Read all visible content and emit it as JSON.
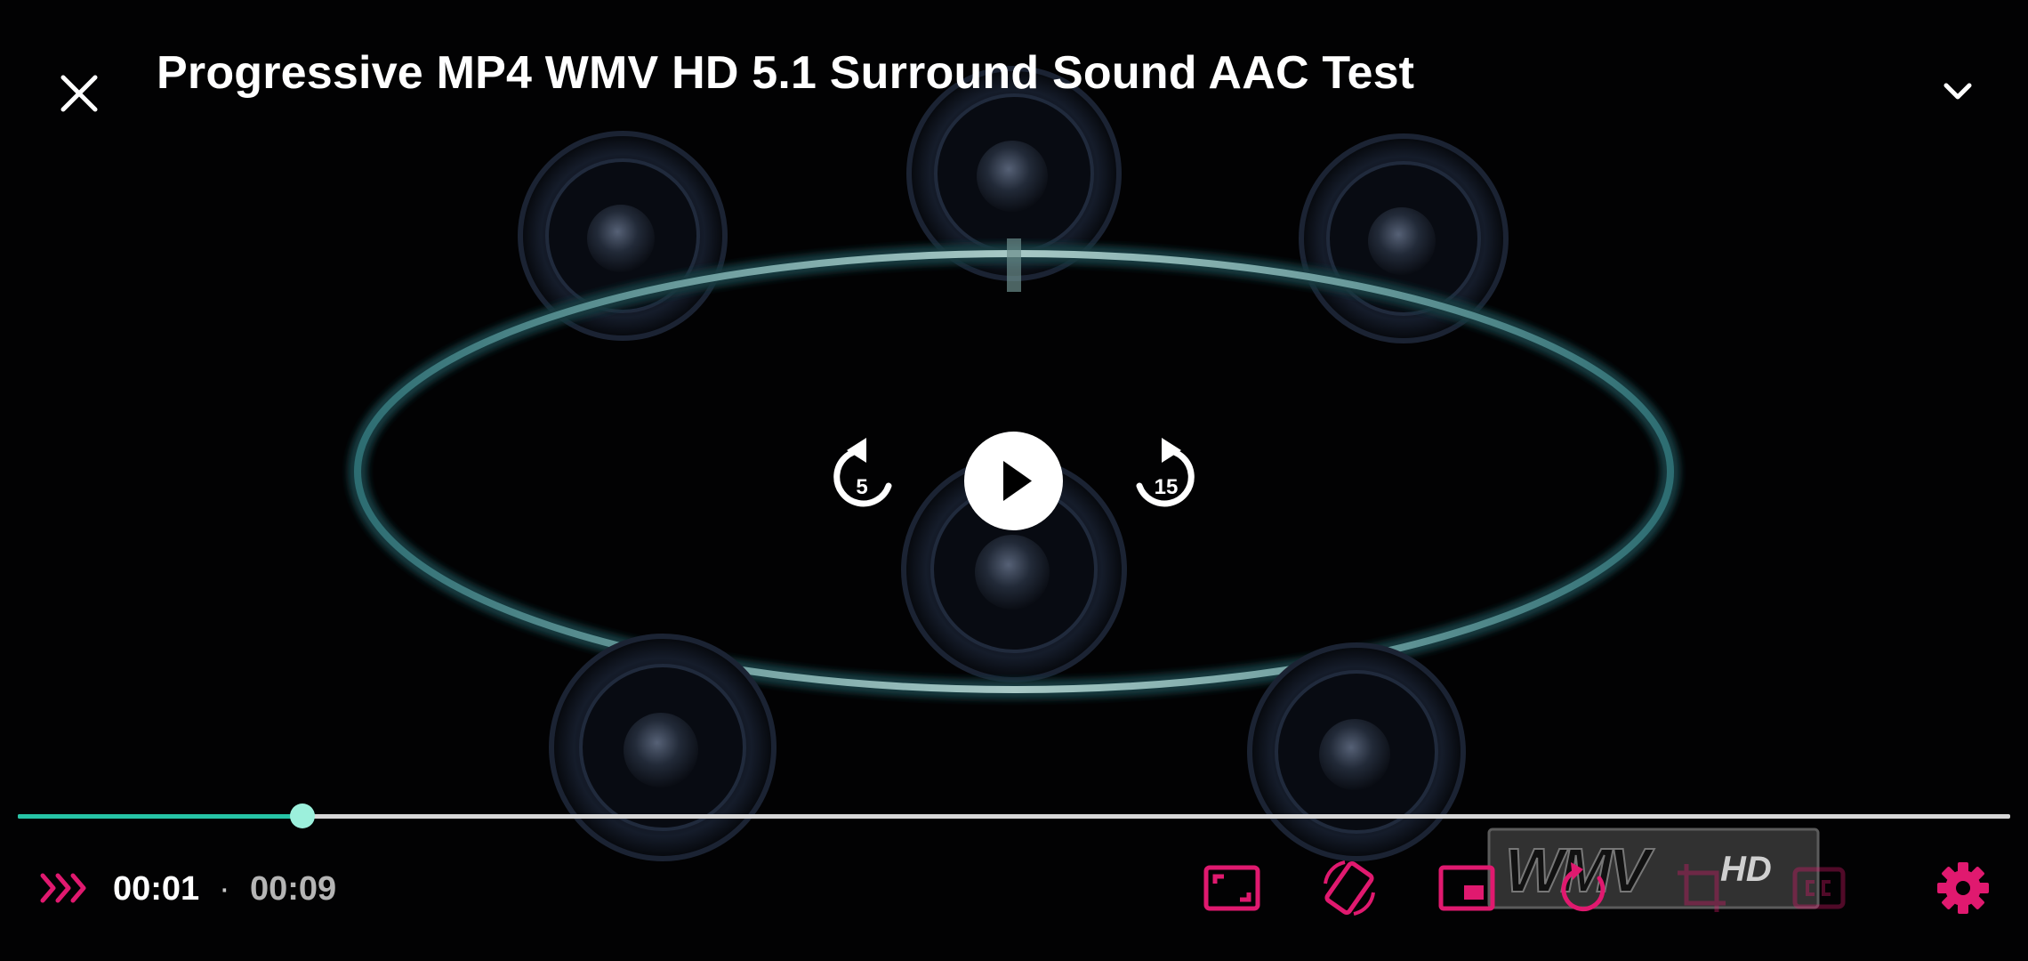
{
  "player": {
    "title": "Progressive MP4 WMV HD 5.1 Surround Sound AAC Test",
    "current_time": "00:01",
    "separator": "·",
    "total_time": "00:09",
    "progress_fraction": 0.143,
    "rewind_seconds": "5",
    "forward_seconds": "15"
  },
  "video": {
    "watermark_text": "WMV HD"
  },
  "icons": {
    "close": "close-icon",
    "collapse": "chevron-down-icon",
    "rewind": "replay-5-icon",
    "play": "play-icon",
    "forward": "forward-15-icon",
    "speed": "triple-chevron-right-icon",
    "aspect": "aspect-ratio-icon",
    "rotate": "screen-rotation-icon",
    "pip": "picture-in-picture-icon",
    "repeat": "repeat-one-icon",
    "crop": "crop-icon",
    "captions": "closed-captions-icon",
    "settings": "settings-gear-icon"
  },
  "colors": {
    "accent": "#e0196f",
    "progress": "#26c4a6",
    "thumb": "#9cf0dc",
    "track": "#d8d8d8",
    "background": "#020203"
  }
}
